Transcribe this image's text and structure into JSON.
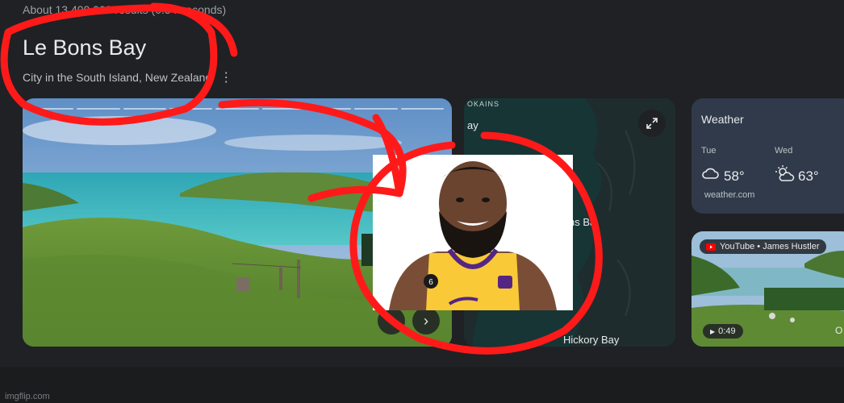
{
  "header": {
    "result_stats": "About 13,400,000 results (0.34 seconds)",
    "title": "Le Bons Bay",
    "subtitle": "City in the South Island, New Zealand",
    "more_icon": "more-vert-icon"
  },
  "photo": {
    "slides": 9,
    "prev_icon": "chevron-left-icon",
    "next_icon": "chevron-right-icon",
    "prev_glyph": "‹",
    "next_glyph": "›"
  },
  "map": {
    "top_label": "OKAINS",
    "bay_label": "ay",
    "place_label": "Le Bons Ba",
    "hickory_label": "Hickory Bay",
    "expand_icon": "expand-icon"
  },
  "weather": {
    "title": "Weather",
    "days": [
      {
        "day": "Tue",
        "temp": "58°",
        "icon": "cloud-icon"
      },
      {
        "day": "Wed",
        "temp": "63°",
        "icon": "partly-cloudy-icon"
      }
    ],
    "source": "weather.com"
  },
  "video": {
    "badge": "YouTube • James Hustler",
    "duration": "0:49",
    "play_glyph": "▶",
    "edge_text": "O"
  },
  "watermark": "imgflip.com",
  "colors": {
    "background": "#202124",
    "weather_card": "#303a4a",
    "map_water": "#173535",
    "map_land": "#1f2c2e",
    "annotation_red": "#ff1a1a",
    "jersey_gold": "#f9c937",
    "jersey_purple": "#552583"
  }
}
